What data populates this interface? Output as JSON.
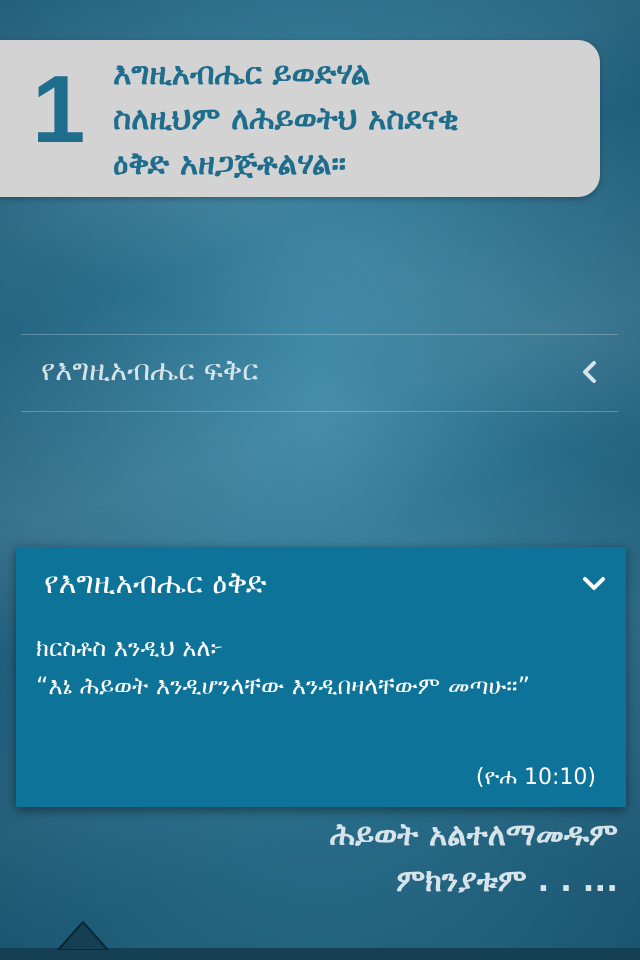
{
  "step": {
    "number": "1",
    "text": "እግዚአብሔር ይወድሃል\nስለዚህም ለሕይወትህ አስደናቂ\nዕቅድ አዘጋጅቶልሃል።"
  },
  "section_love": {
    "label": "የእግዚአብሔር ፍቅር",
    "chevron_icon": "chevron-left-icon"
  },
  "section_plan": {
    "title": "የእግዚአብሔር ዕቅድ",
    "chevron_icon": "chevron-down-icon",
    "body_line1": "ክርስቶስ እንዲህ አለ፦",
    "body_line2": "“እኔ ሕይወት እንዲሆንላቸው እንዲበዛላቸውም መጣሁ፡፡”",
    "reference": "(ዮሐ 10:10)"
  },
  "behind_text": {
    "line1": "ሕይወት አልተለማመዱም",
    "line2": "ምክንያቱም . . ..."
  },
  "colors": {
    "background": "#2a6f8c",
    "card": "#d3d3d3",
    "accent": "#1f6d8c",
    "panel": "#0e7398"
  }
}
